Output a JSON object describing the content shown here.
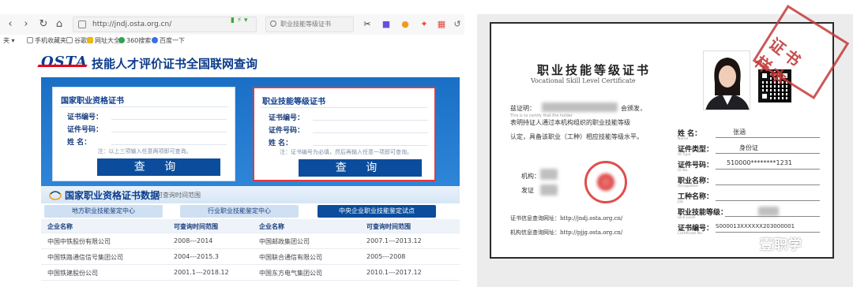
{
  "browser": {
    "url": "http://jndj.osta.org.cn/",
    "search_placeholder": "职业技能等级证书",
    "bookmarks": [
      "手机收藏夹",
      "谷歌",
      "网址大全",
      "360搜索",
      "百度一下"
    ]
  },
  "site": {
    "logo": "OSTA",
    "title": "技能人才评价证书全国联网查询"
  },
  "left_card": {
    "title": "国家职业资格证书",
    "fields": [
      "证书编号：",
      "证件号码：",
      "姓    名："
    ],
    "hint": "注：以上三项输入任意两项即可查询。",
    "button": "查 询"
  },
  "right_card": {
    "title": "职业技能等级证书",
    "fields": [
      "证书编号：",
      "证件号码：",
      "姓    名："
    ],
    "hint": "注：证书编号为必填，然后再输入任意一项即可查询。",
    "button": "查 询"
  },
  "data_section": {
    "title": "国家职业资格证书数据",
    "subtitle": "可查询时间范围",
    "tabs": [
      "地方职业技能鉴定中心",
      "行业职业技能鉴定中心",
      "中央企业职业技能鉴定试点"
    ],
    "active_tab": 2,
    "headers": [
      "企业名称",
      "可查询时间范围",
      "企业名称",
      "可查询时间范围"
    ],
    "rows": [
      [
        "中国中铁股份有限公司",
        "2008---2014",
        "中国邮政集团公司",
        "2007.1---2013.12"
      ],
      [
        "中国铁路通信信号集团公司",
        "2004---2015.3",
        "中国联合通信有限公司",
        "2005---2008"
      ],
      [
        "中国铁建股份公司",
        "2001.1---2018.12",
        "中国东方电气集团公司",
        "2010.1---2017.12"
      ]
    ]
  },
  "certificate": {
    "title": "职业技能等级证书",
    "subtitle": "Vocational Skill Level Certificate",
    "body_lines": [
      "兹证明：",
      "表明持证人通过本机构组织的职业技能等级",
      "认定，具备该职业（工种）相应技能等级水平。"
    ],
    "body_suffix": "会颁发，",
    "org_label": "机构：",
    "date_label": "发证",
    "stamp": "证书样本",
    "fields": [
      {
        "label": "姓    名：",
        "en": "Name",
        "value": "张涵"
      },
      {
        "label": "证件类型：",
        "en": "ID Type",
        "value": "身份证"
      },
      {
        "label": "证件号码：",
        "en": "ID No.",
        "value": "510000********1231"
      },
      {
        "label": "职业名称：",
        "en": "Occupation",
        "value": ""
      },
      {
        "label": "工种名称：",
        "en": "Job",
        "value": ""
      },
      {
        "label": "职业技能等级：",
        "en": "Skill Level",
        "value": ""
      },
      {
        "label": "证书编号：",
        "en": "Certificate No.",
        "value": "S000013XXXXXX203000001"
      }
    ],
    "footer": [
      "证书信息查询网址：http://jndj.osta.org.cn/",
      "机构信息查询网址：http://pjjg.osta.org.cn/"
    ]
  },
  "watermark": "壹职学"
}
